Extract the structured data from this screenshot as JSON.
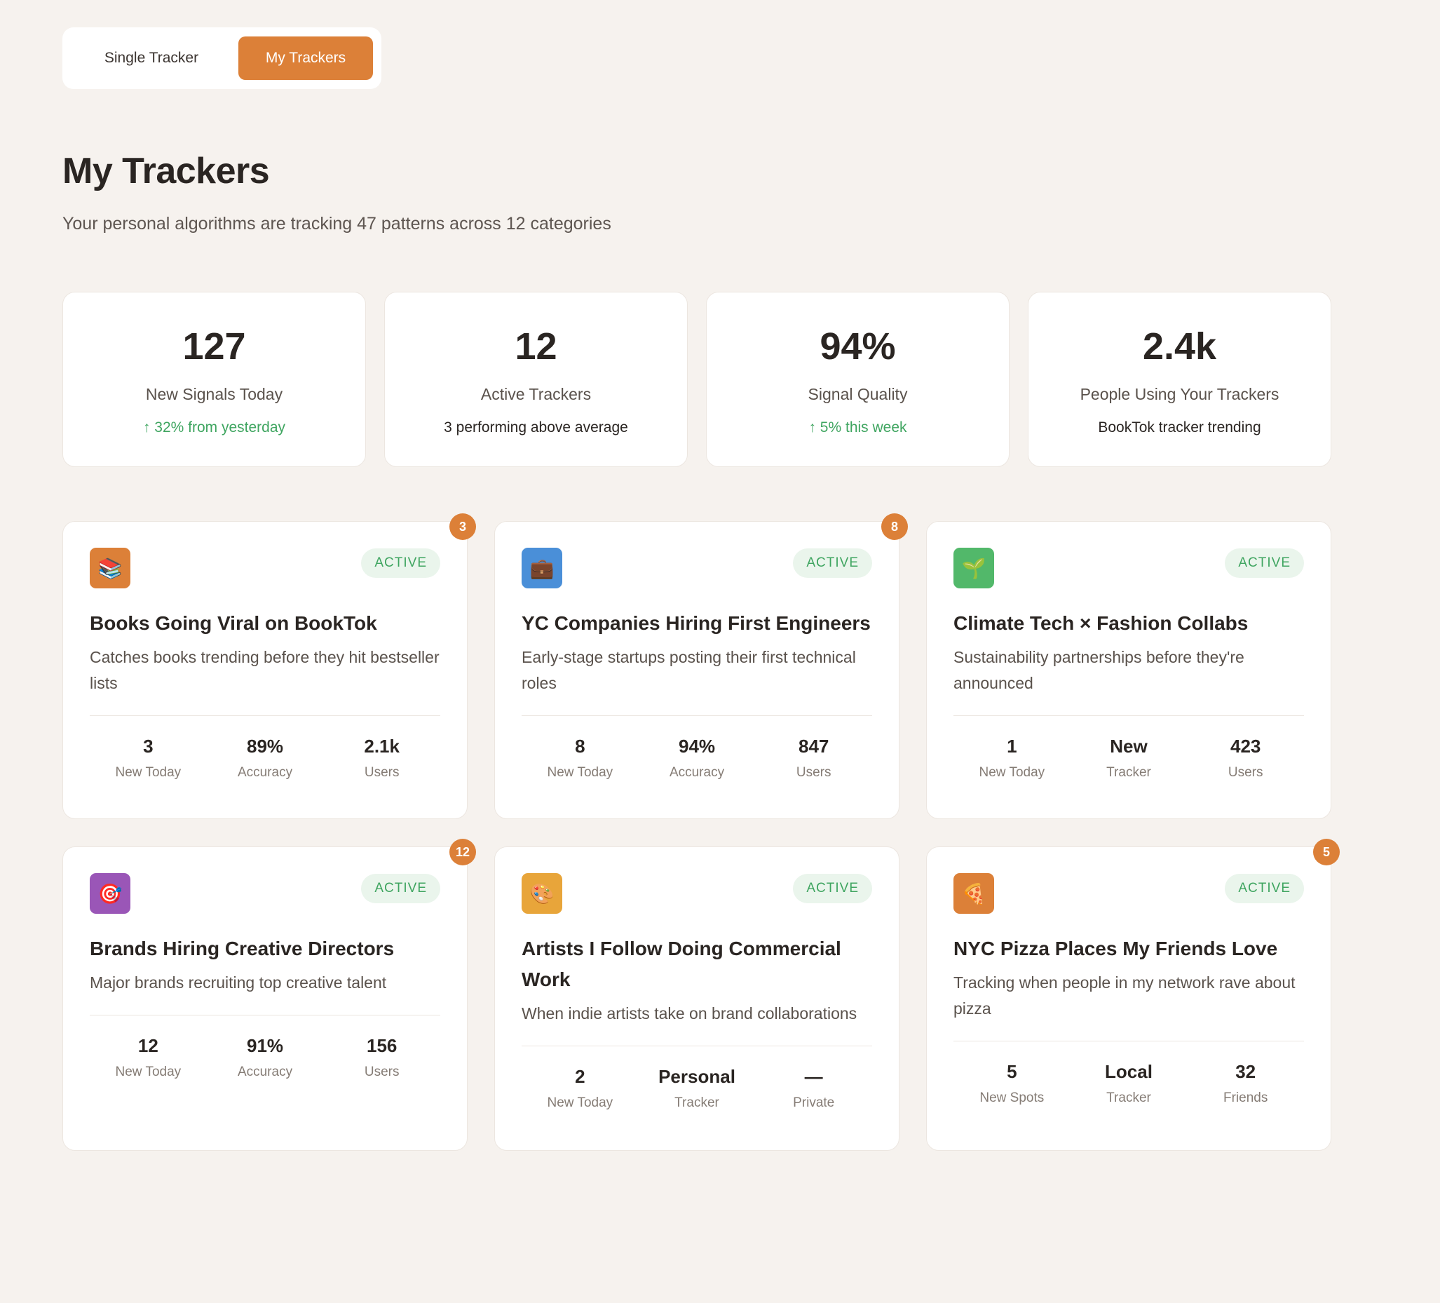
{
  "toggle": {
    "single_label": "Single Tracker",
    "mine_label": "My Trackers"
  },
  "header": {
    "title": "My Trackers",
    "subtitle": "Your personal algorithms are tracking 47 patterns across 12 categories"
  },
  "stats": [
    {
      "value": "127",
      "label": "New Signals Today",
      "sub": "↑ 32% from yesterday",
      "trend": "up"
    },
    {
      "value": "12",
      "label": "Active Trackers",
      "sub": "3 performing above average",
      "trend": "none"
    },
    {
      "value": "94%",
      "label": "Signal Quality",
      "sub": "↑ 5% this week",
      "trend": "up"
    },
    {
      "value": "2.4k",
      "label": "People Using Your Trackers",
      "sub": "BookTok tracker trending",
      "trend": "none"
    }
  ],
  "trackers": [
    {
      "icon": "books-icon",
      "icon_glyph": "📚",
      "icon_color": "#dc8038",
      "status": "ACTIVE",
      "badge": "3",
      "name": "Books Going Viral on BookTok",
      "description": "Catches books trending before they hit bestseller lists",
      "metrics": [
        {
          "value": "3",
          "label": "New Today"
        },
        {
          "value": "89%",
          "label": "Accuracy"
        },
        {
          "value": "2.1k",
          "label": "Users"
        }
      ]
    },
    {
      "icon": "briefcase-icon",
      "icon_glyph": "💼",
      "icon_color": "#4a8fd8",
      "status": "ACTIVE",
      "badge": "8",
      "name": "YC Companies Hiring First Engineers",
      "description": "Early-stage startups posting their first technical roles",
      "metrics": [
        {
          "value": "8",
          "label": "New Today"
        },
        {
          "value": "94%",
          "label": "Accuracy"
        },
        {
          "value": "847",
          "label": "Users"
        }
      ]
    },
    {
      "icon": "seedling-icon",
      "icon_glyph": "🌱",
      "icon_color": "#52b86a",
      "status": "ACTIVE",
      "badge": "",
      "name": "Climate Tech × Fashion Collabs",
      "description": "Sustainability partnerships before they're announced",
      "metrics": [
        {
          "value": "1",
          "label": "New Today"
        },
        {
          "value": "New",
          "label": "Tracker"
        },
        {
          "value": "423",
          "label": "Users"
        }
      ]
    },
    {
      "icon": "target-icon",
      "icon_glyph": "🎯",
      "icon_color": "#9a56b7",
      "status": "ACTIVE",
      "badge": "12",
      "name": "Brands Hiring Creative Directors",
      "description": "Major brands recruiting top creative talent",
      "metrics": [
        {
          "value": "12",
          "label": "New Today"
        },
        {
          "value": "91%",
          "label": "Accuracy"
        },
        {
          "value": "156",
          "label": "Users"
        }
      ]
    },
    {
      "icon": "palette-icon",
      "icon_glyph": "🎨",
      "icon_color": "#e8a53a",
      "status": "ACTIVE",
      "badge": "",
      "name": "Artists I Follow Doing Commercial Work",
      "description": "When indie artists take on brand collaborations",
      "metrics": [
        {
          "value": "2",
          "label": "New Today"
        },
        {
          "value": "Personal",
          "label": "Tracker"
        },
        {
          "value": "—",
          "label": "Private"
        }
      ]
    },
    {
      "icon": "pizza-icon",
      "icon_glyph": "🍕",
      "icon_color": "#dc8038",
      "status": "ACTIVE",
      "badge": "5",
      "name": "NYC Pizza Places My Friends Love",
      "description": "Tracking when people in my network rave about pizza",
      "metrics": [
        {
          "value": "5",
          "label": "New Spots"
        },
        {
          "value": "Local",
          "label": "Tracker"
        },
        {
          "value": "32",
          "label": "Friends"
        }
      ]
    }
  ]
}
